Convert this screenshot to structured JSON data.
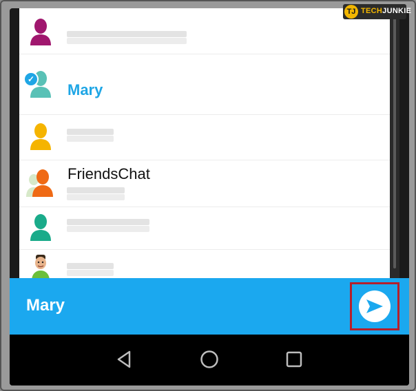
{
  "contacts": [
    {
      "name": "",
      "avatar_icon": "user-silhouette-icon",
      "avatar_color": "#a0176e",
      "selected": false
    },
    {
      "name": "Mary",
      "avatar_icon": "user-silhouette-icon",
      "avatar_color": "#59c1b6",
      "selected": true,
      "name_color": "#1fa6e5"
    },
    {
      "name": "",
      "avatar_icon": "user-silhouette-icon",
      "avatar_color": "#f5b400",
      "selected": false
    },
    {
      "name": "FriendsChat",
      "avatar_icon": "group-silhouette-icon",
      "avatar_color": "#ef6a15",
      "selected": false,
      "name_color": "#111111"
    },
    {
      "name": "",
      "avatar_icon": "user-silhouette-icon",
      "avatar_color": "#1aab8a",
      "selected": false
    },
    {
      "name": "",
      "avatar_icon": "bitmoji-avatar-icon",
      "avatar_color": "#6bbf3a",
      "selected": false
    }
  ],
  "send_bar": {
    "recipient": "Mary",
    "send_icon": "send-arrow-icon",
    "background_color": "#1ba8ef",
    "highlight_color": "#b51f2b"
  },
  "nav_bar": {
    "back_icon": "back-triangle-icon",
    "home_icon": "home-circle-icon",
    "recents_icon": "recents-square-icon"
  },
  "watermark": {
    "mark": "TJ",
    "text_prefix": "TECH",
    "text_suffix": "JUNKIE"
  }
}
